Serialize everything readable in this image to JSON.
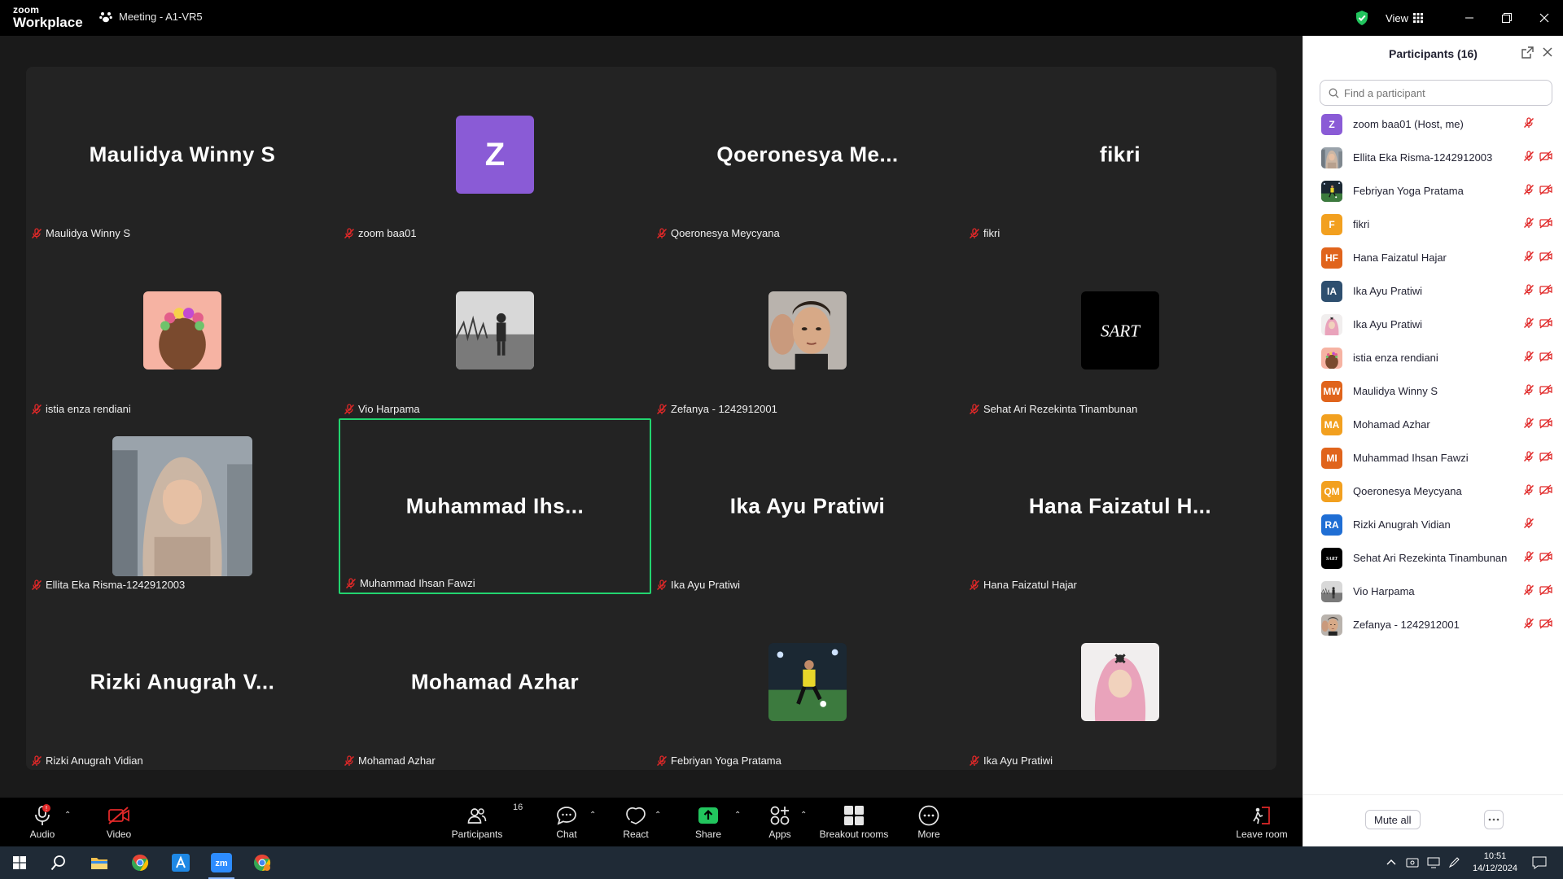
{
  "titlebar": {
    "logo_top": "zoom",
    "logo_bottom": "Workplace",
    "meeting_title": "Meeting - A1-VR5",
    "view_label": "View"
  },
  "tiles": [
    {
      "display": "Maulidya Winny S",
      "label": "Maulidya Winny S",
      "kind": "name"
    },
    {
      "display": "Z",
      "label": "zoom baa01",
      "kind": "letter",
      "color": "#8a5bd6"
    },
    {
      "display": "Qoeronesya  Me...",
      "label": "Qoeronesya Meycyana",
      "kind": "name"
    },
    {
      "display": "fikri",
      "label": "fikri",
      "kind": "name"
    },
    {
      "display": "",
      "label": "istia enza rendiani",
      "kind": "photo",
      "icon": "flower-crown-photo"
    },
    {
      "display": "",
      "label": "Vio Harpama",
      "kind": "photo",
      "icon": "field-silhouette-photo"
    },
    {
      "display": "",
      "label": "Zefanya - 1242912001",
      "kind": "photo",
      "icon": "face-portrait-photo"
    },
    {
      "display": "",
      "label": "Sehat Ari Rezekinta Tinambunan",
      "kind": "photo",
      "icon": "signature-logo-photo",
      "logo_text": "SART"
    },
    {
      "display": "",
      "label": "Ellita Eka Risma-1242912003",
      "kind": "photo",
      "icon": "hijab-portrait-photo"
    },
    {
      "display": "Muhammad  Ihs...",
      "label": "Muhammad Ihsan Fawzi",
      "kind": "name",
      "active": true
    },
    {
      "display": "Ika Ayu Pratiwi",
      "label": "Ika Ayu Pratiwi",
      "kind": "name"
    },
    {
      "display": "Hana Faizatul H...",
      "label": "Hana Faizatul Hajar",
      "kind": "name"
    },
    {
      "display": "Rizki  Anugrah  V...",
      "label": "Rizki Anugrah Vidian",
      "kind": "name"
    },
    {
      "display": "Mohamad Azhar",
      "label": "Mohamad Azhar",
      "kind": "name"
    },
    {
      "display": "",
      "label": "Febriyan Yoga Pratama",
      "kind": "photo",
      "icon": "football-player-photo"
    },
    {
      "display": "",
      "label": "Ika Ayu Pratiwi",
      "kind": "photo",
      "icon": "pink-hijab-photo"
    }
  ],
  "panel": {
    "title": "Participants (16)",
    "search_placeholder": "Find a participant",
    "mute_all": "Mute all",
    "participants": [
      {
        "name": "zoom baa01 (Host, me)",
        "initials": "Z",
        "color": "#8a5bd6",
        "video_off": false
      },
      {
        "name": "Ellita Eka Risma-1242912003",
        "initials": "",
        "color": "#9e8f86",
        "video_off": true
      },
      {
        "name": "Febriyan Yoga Pratama",
        "initials": "",
        "color": "#2f5d3f",
        "video_off": true
      },
      {
        "name": "fikri",
        "initials": "F",
        "color": "#f2a01f",
        "video_off": true
      },
      {
        "name": "Hana Faizatul Hajar",
        "initials": "HF",
        "color": "#e0641c",
        "video_off": true
      },
      {
        "name": "Ika Ayu Pratiwi",
        "initials": "IA",
        "color": "#2e4f6f",
        "video_off": true
      },
      {
        "name": "Ika Ayu Pratiwi",
        "initials": "",
        "color": "#e7b7c3",
        "video_off": true
      },
      {
        "name": "istia enza rendiani",
        "initials": "",
        "color": "#c96a6a",
        "video_off": true
      },
      {
        "name": "Maulidya Winny S",
        "initials": "MW",
        "color": "#e0641c",
        "video_off": true
      },
      {
        "name": "Mohamad Azhar",
        "initials": "MA",
        "color": "#f2a01f",
        "video_off": true
      },
      {
        "name": "Muhammad Ihsan Fawzi",
        "initials": "MI",
        "color": "#e0641c",
        "video_off": true
      },
      {
        "name": "Qoeronesya Meycyana",
        "initials": "QM",
        "color": "#f2a01f",
        "video_off": true
      },
      {
        "name": "Rizki Anugrah Vidian",
        "initials": "RA",
        "color": "#1f6ed4",
        "video_off": false
      },
      {
        "name": "Sehat Ari Rezekinta Tinambunan",
        "initials": "",
        "color": "#000000",
        "video_off": true
      },
      {
        "name": "Vio Harpama",
        "initials": "",
        "color": "#555555",
        "video_off": true
      },
      {
        "name": "Zefanya - 1242912001",
        "initials": "",
        "color": "#8c6b5a",
        "video_off": true
      }
    ]
  },
  "toolbar": {
    "audio": "Audio",
    "video": "Video",
    "participants": "Participants",
    "participants_count": "16",
    "chat": "Chat",
    "react": "React",
    "share": "Share",
    "apps": "Apps",
    "breakout": "Breakout rooms",
    "more": "More",
    "leave": "Leave room"
  },
  "taskbar": {
    "time": "10:51",
    "date": "14/12/2024"
  },
  "colors": {
    "active_speaker": "#22d46f",
    "mic_off": "#e02828",
    "share_green": "#22c55e"
  }
}
